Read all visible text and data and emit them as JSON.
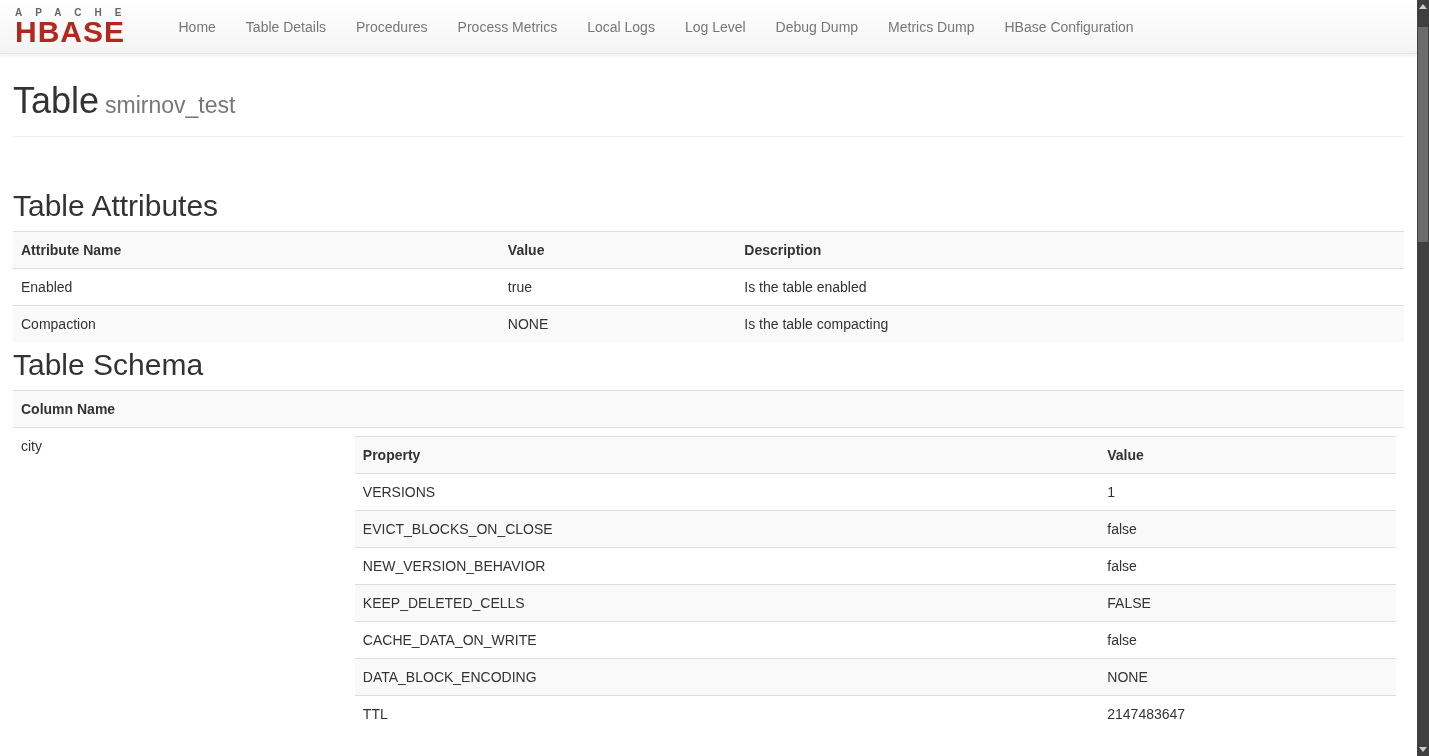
{
  "brand": {
    "top": "APACHE",
    "bottom": "HBASE"
  },
  "nav": [
    "Home",
    "Table Details",
    "Procedures",
    "Process Metrics",
    "Local Logs",
    "Log Level",
    "Debug Dump",
    "Metrics Dump",
    "HBase Configuration"
  ],
  "page_header": {
    "title": "Table",
    "subtitle": "smirnov_test"
  },
  "attributes": {
    "heading": "Table Attributes",
    "columns": [
      "Attribute Name",
      "Value",
      "Description"
    ],
    "rows": [
      [
        "Enabled",
        "true",
        "Is the table enabled"
      ],
      [
        "Compaction",
        "NONE",
        "Is the table compacting"
      ]
    ]
  },
  "schema": {
    "heading": "Table Schema",
    "columns": [
      "Column Name"
    ],
    "families": [
      {
        "name": "city",
        "columns": [
          "Property",
          "Value"
        ],
        "rows": [
          [
            "VERSIONS",
            "1"
          ],
          [
            "EVICT_BLOCKS_ON_CLOSE",
            "false"
          ],
          [
            "NEW_VERSION_BEHAVIOR",
            "false"
          ],
          [
            "KEEP_DELETED_CELLS",
            "FALSE"
          ],
          [
            "CACHE_DATA_ON_WRITE",
            "false"
          ],
          [
            "DATA_BLOCK_ENCODING",
            "NONE"
          ],
          [
            "TTL",
            "2147483647"
          ]
        ]
      }
    ]
  }
}
